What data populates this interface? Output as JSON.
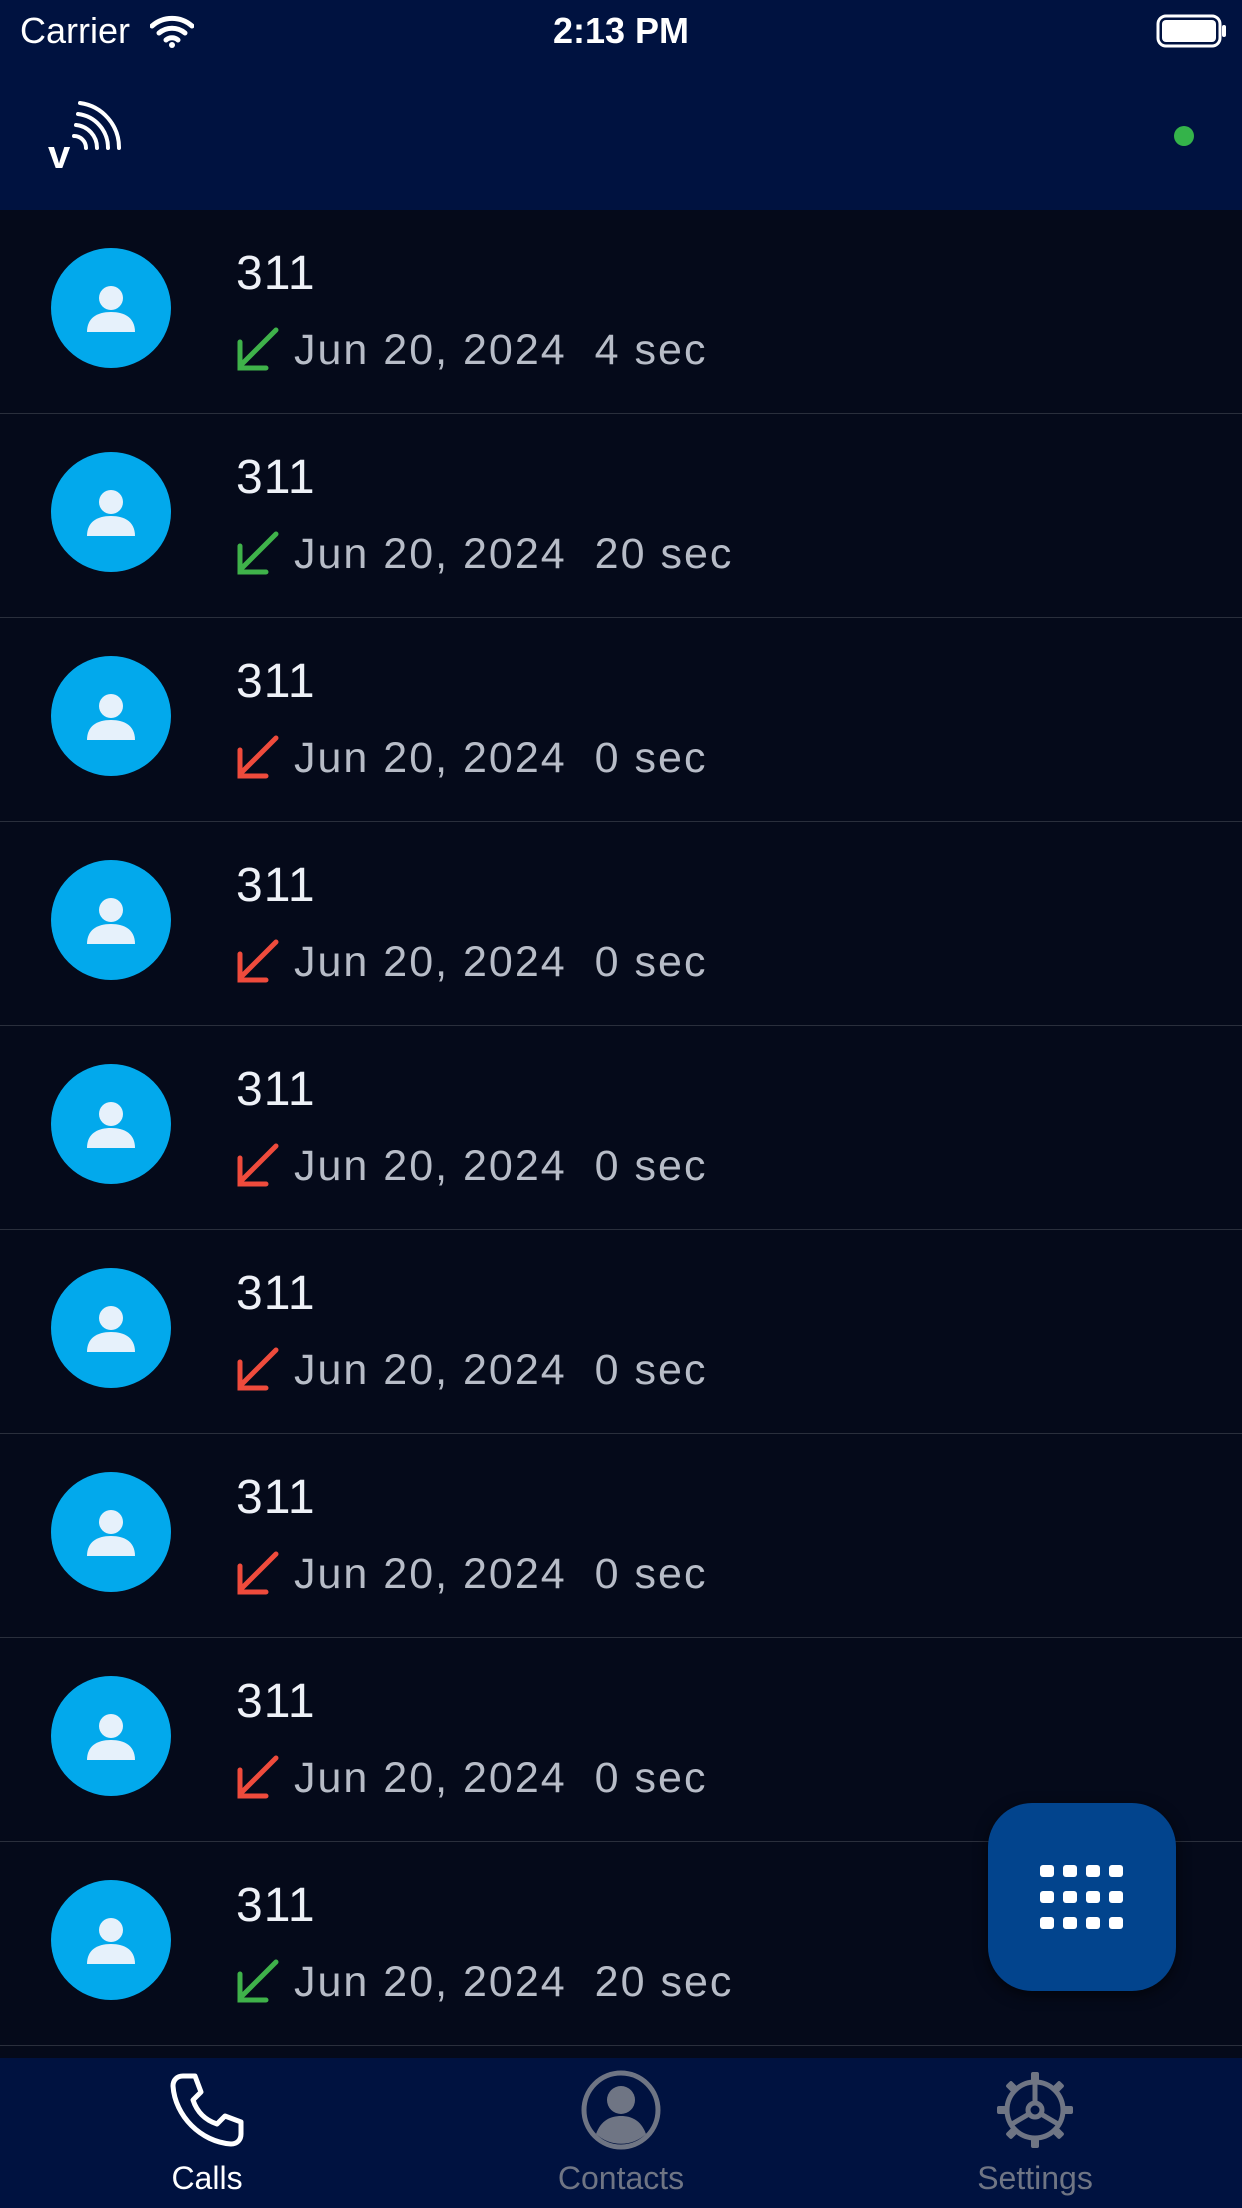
{
  "status_bar": {
    "carrier": "Carrier",
    "time": "2:13 PM"
  },
  "header": {
    "logo_text": "v",
    "connection_color": "#34b34a"
  },
  "colors": {
    "incoming": "#3fb24a",
    "missed": "#ef4b3c",
    "avatar": "#02a9ec",
    "fab": "#02448d"
  },
  "calls": [
    {
      "name": "311",
      "date": "Jun 20, 2024",
      "duration": "4 sec",
      "type": "incoming"
    },
    {
      "name": "311",
      "date": "Jun 20, 2024",
      "duration": "20 sec",
      "type": "incoming"
    },
    {
      "name": "311",
      "date": "Jun 20, 2024",
      "duration": "0 sec",
      "type": "missed"
    },
    {
      "name": "311",
      "date": "Jun 20, 2024",
      "duration": "0 sec",
      "type": "missed"
    },
    {
      "name": "311",
      "date": "Jun 20, 2024",
      "duration": "0 sec",
      "type": "missed"
    },
    {
      "name": "311",
      "date": "Jun 20, 2024",
      "duration": "0 sec",
      "type": "missed"
    },
    {
      "name": "311",
      "date": "Jun 20, 2024",
      "duration": "0 sec",
      "type": "missed"
    },
    {
      "name": "311",
      "date": "Jun 20, 2024",
      "duration": "0 sec",
      "type": "missed"
    },
    {
      "name": "311",
      "date": "Jun 20, 2024",
      "duration": "20 sec",
      "type": "incoming"
    }
  ],
  "tabs": [
    {
      "label": "Calls",
      "icon": "phone-icon",
      "active": true
    },
    {
      "label": "Contacts",
      "icon": "person-circle-icon",
      "active": false
    },
    {
      "label": "Settings",
      "icon": "gear-icon",
      "active": false
    }
  ]
}
